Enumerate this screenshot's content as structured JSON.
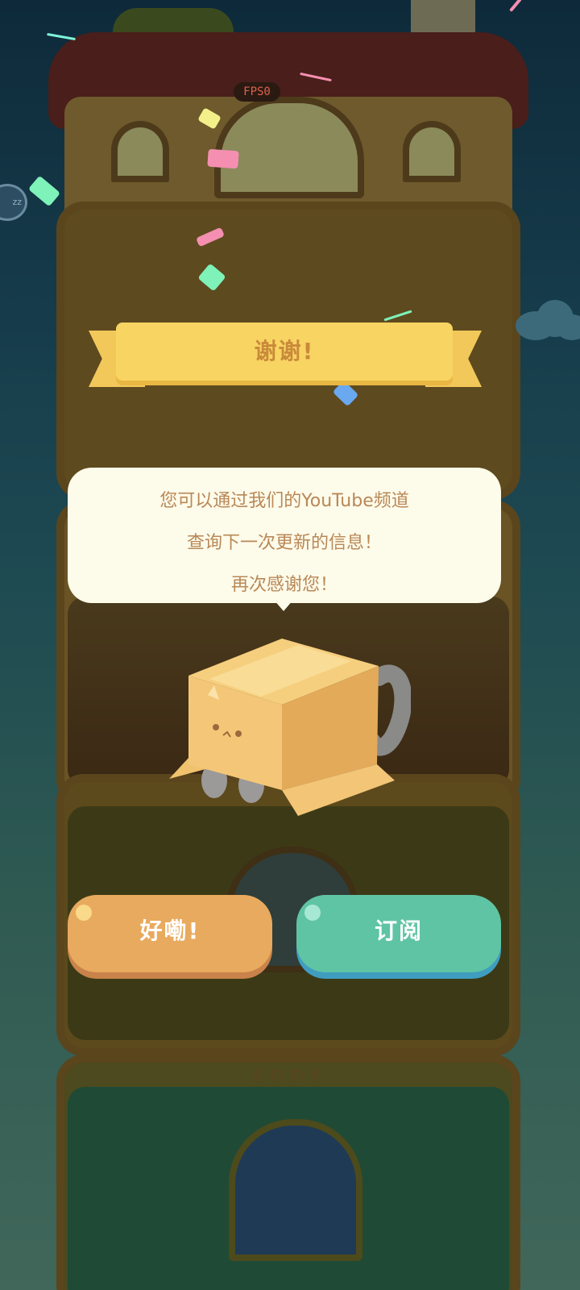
{
  "hud": {
    "fps_label": "FPS0",
    "sleep_badge": "zz"
  },
  "banner": {
    "title": "谢谢!"
  },
  "dialog": {
    "lines": [
      "您可以通过我们的YouTube频道",
      "查询下一次更新的信息！",
      "再次感谢您！"
    ]
  },
  "buttons": {
    "ok_label": "好嘞!",
    "subscribe_label": "订阅"
  },
  "scene": {
    "floor_sign": "EDDY"
  },
  "colors": {
    "banner": "#f8d463",
    "banner_text": "#c98a3a",
    "bubble": "#fdfbea",
    "bubble_text": "#b98857",
    "ok_button": "#e8aa5e",
    "subscribe_button": "#5fc4a4"
  }
}
